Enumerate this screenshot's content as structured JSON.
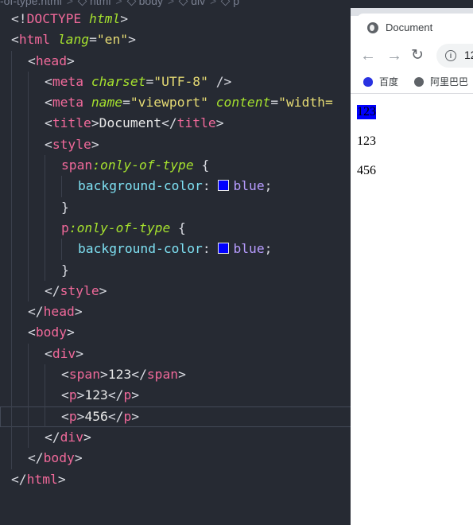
{
  "editor": {
    "breadcrumb": [
      "-of-type.html",
      "html",
      "body",
      "div",
      "p"
    ],
    "code": {
      "doctype_open": "<!",
      "doctype_kw": "DOCTYPE",
      "doctype_arg": "html",
      "doctype_close": ">",
      "html_tag": "html",
      "lang_attr": "lang",
      "lang_val": "\"en\"",
      "head_tag": "head",
      "meta_tag": "meta",
      "charset_attr": "charset",
      "charset_val": "\"UTF-8\"",
      "meta_self_close": " />",
      "name_attr": "name",
      "name_val": "\"viewport\"",
      "content_attr": "content",
      "content_val": "\"width=",
      "title_tag": "title",
      "title_text": "Document",
      "style_tag": "style",
      "rule1_selector": "span",
      "rule1_pseudo": ":only-of-type",
      "rule2_selector": "p",
      "rule2_pseudo": ":only-of-type",
      "open_brace": " {",
      "close_brace": "}",
      "prop_name": "background-color",
      "prop_colon": ": ",
      "prop_value": "blue",
      "semicolon": ";",
      "body_tag": "body",
      "div_tag": "div",
      "span_tag": "span",
      "p_tag": "p",
      "span_text": "123",
      "p1_text": "123",
      "p2_text": "456"
    },
    "swatch_color": "#0000ff"
  },
  "browser": {
    "tab_title": "Document",
    "tab_icon": "globe-icon",
    "nav": {
      "back": "←",
      "forward": "→",
      "reload": "↻"
    },
    "info_icon": "i",
    "url_partial": "12",
    "bookmarks": [
      {
        "label": "百度",
        "icon": "baidu-paw-icon"
      },
      {
        "label": "阿里巴巴",
        "icon": "globe-icon"
      }
    ],
    "output": [
      "123",
      "123",
      "456"
    ],
    "highlight_color": "#0000ff"
  }
}
